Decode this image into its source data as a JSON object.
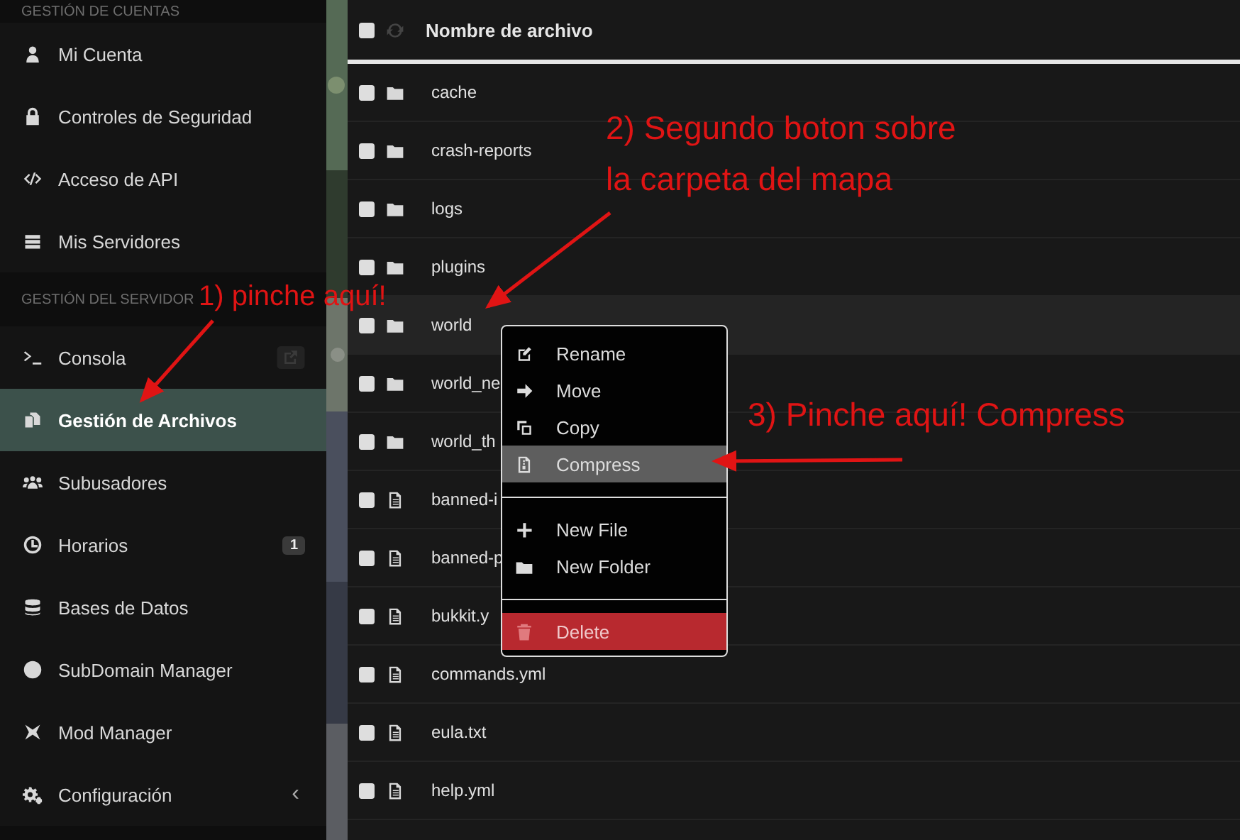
{
  "sidebar": {
    "sections": [
      {
        "title": "GESTIÓN DE CUENTAS",
        "items": [
          {
            "label": "Mi Cuenta",
            "selected": false
          },
          {
            "label": "Controles de Seguridad",
            "selected": false
          },
          {
            "label": "Acceso de API",
            "selected": false
          },
          {
            "label": "Mis Servidores",
            "selected": false
          }
        ]
      },
      {
        "title": "GESTIÓN DEL SERVIDOR",
        "items": [
          {
            "label": "Consola",
            "selected": false,
            "external": true
          },
          {
            "label": "Gestión de Archivos",
            "selected": true
          },
          {
            "label": "Subusadores",
            "selected": false
          },
          {
            "label": "Horarios",
            "selected": false,
            "badge": "1"
          },
          {
            "label": "Bases de Datos",
            "selected": false
          },
          {
            "label": "SubDomain Manager",
            "selected": false
          },
          {
            "label": "Mod Manager",
            "selected": false
          },
          {
            "label": "Configuración",
            "selected": false,
            "chevron": "‹"
          }
        ]
      }
    ]
  },
  "table": {
    "header": "Nombre de archivo",
    "select_all": {
      "checked": false
    },
    "rows": [
      {
        "name": "cache",
        "kind": "folder",
        "selected": false,
        "checked": false
      },
      {
        "name": "crash-reports",
        "kind": "folder",
        "selected": false,
        "checked": false
      },
      {
        "name": "logs",
        "kind": "folder",
        "selected": false,
        "checked": false
      },
      {
        "name": "plugins",
        "kind": "folder",
        "selected": false,
        "checked": false
      },
      {
        "name": "world",
        "kind": "folder",
        "selected": true,
        "checked": false
      },
      {
        "name": "world_ne",
        "kind": "folder",
        "selected": false,
        "checked": false
      },
      {
        "name": "world_th",
        "kind": "folder",
        "selected": false,
        "checked": false
      },
      {
        "name": "banned-i",
        "kind": "file",
        "selected": false,
        "checked": false
      },
      {
        "name": "banned-p",
        "kind": "file",
        "selected": false,
        "checked": false
      },
      {
        "name": "bukkit.y",
        "kind": "file",
        "selected": false,
        "checked": false
      },
      {
        "name": "commands.yml",
        "kind": "file",
        "selected": false,
        "checked": false
      },
      {
        "name": "eula.txt",
        "kind": "file",
        "selected": false,
        "checked": false
      },
      {
        "name": "help.yml",
        "kind": "file",
        "selected": false,
        "checked": false
      }
    ]
  },
  "context_menu": {
    "groups": [
      [
        {
          "label": "Rename",
          "kind": "normal",
          "selected": false
        },
        {
          "label": "Move",
          "kind": "normal",
          "selected": false
        },
        {
          "label": "Copy",
          "kind": "normal",
          "selected": false
        },
        {
          "label": "Compress",
          "kind": "normal",
          "selected": true
        }
      ],
      [
        {
          "label": "New File",
          "kind": "normal",
          "selected": false
        },
        {
          "label": "New Folder",
          "kind": "normal",
          "selected": false
        }
      ],
      [
        {
          "label": "Delete",
          "kind": "danger",
          "selected": false
        }
      ]
    ]
  },
  "annotations": [
    {
      "lines": [
        "1) pinche aquí!"
      ]
    },
    {
      "lines": [
        "2) Segundo boton sobre",
        "la carpeta del mapa"
      ]
    },
    {
      "lines": [
        "3) Pinche aquí! Compress"
      ]
    }
  ]
}
